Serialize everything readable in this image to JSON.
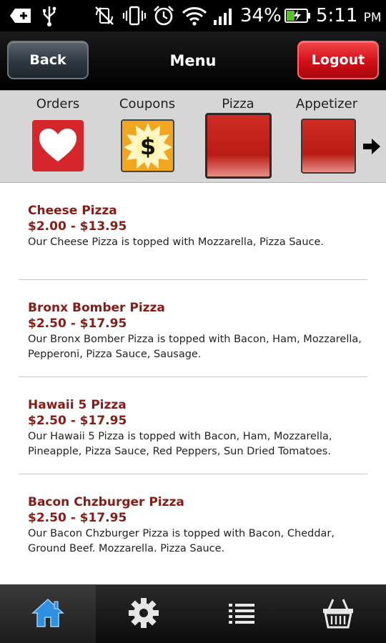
{
  "status_bar": {
    "battery_percent": "34%",
    "time": "5:11",
    "time_suffix": "PM",
    "icons": [
      "usb-icon",
      "rotate-lock-icon",
      "vibrate-icon",
      "alarm-icon",
      "wifi-icon",
      "signal-icon",
      "battery-charging-icon"
    ]
  },
  "nav": {
    "back_label": "Back",
    "title": "Menu",
    "logout_label": "Logout"
  },
  "categories": [
    {
      "label": "Orders",
      "icon": "heart-icon"
    },
    {
      "label": "Coupons",
      "icon": "dollar-badge-icon"
    },
    {
      "label": "Pizza",
      "icon": "red-tile",
      "selected": true
    },
    {
      "label": "Appetizer",
      "icon": "red-tile"
    }
  ],
  "menu_items": [
    {
      "name": "Cheese Pizza",
      "price": "$2.00 - $13.95",
      "description": "Our Cheese Pizza is topped with Mozzarella, Pizza Sauce."
    },
    {
      "name": "Bronx Bomber Pizza",
      "price": "$2.50 - $17.95",
      "description": "Our Bronx Bomber Pizza is topped with Bacon, Ham, Mozzarella, Pepperoni, Pizza Sauce, Sausage."
    },
    {
      "name": "Hawaii 5 Pizza",
      "price": "$2.50 - $17.95",
      "description": "Our Hawaii 5 Pizza is topped with Bacon, Ham, Mozzarella, Pineapple, Pizza Sauce, Red Peppers, Sun Dried Tomatoes."
    },
    {
      "name": "Bacon Chzburger Pizza",
      "price": "$2.50 - $17.95",
      "description": "Our Bacon Chzburger Pizza is topped with Bacon, Cheddar, Ground Beef. Mozzarella. Pizza Sauce."
    }
  ],
  "tabs": [
    {
      "icon": "home-icon",
      "active": true
    },
    {
      "icon": "gear-icon"
    },
    {
      "icon": "list-icon"
    },
    {
      "icon": "basket-icon"
    }
  ],
  "colors": {
    "accent_red": "#d10f17",
    "item_title": "#8a1a14",
    "tab_active_icon": "#2f8fe0"
  }
}
